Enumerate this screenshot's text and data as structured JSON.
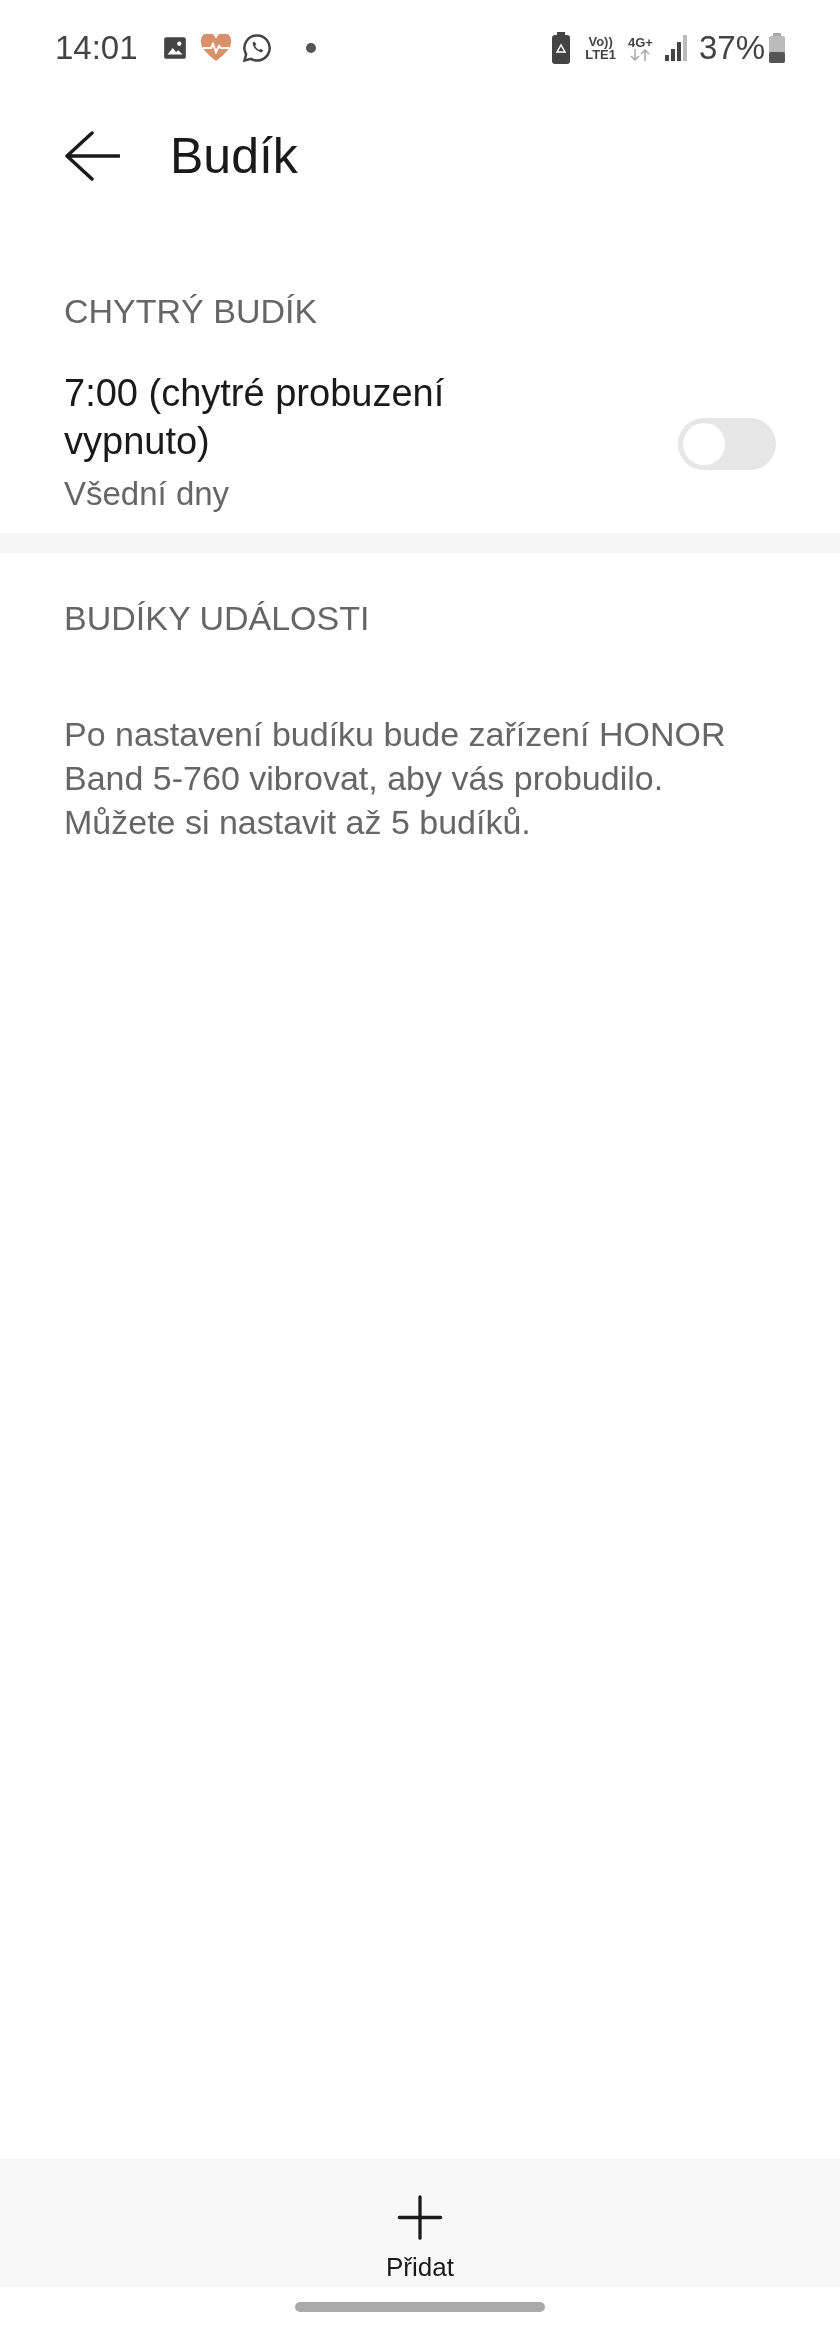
{
  "status_bar": {
    "time": "14:01",
    "volte_top": "Vo))",
    "volte_bottom": "LTE1",
    "network": "4G+",
    "battery": "37%"
  },
  "header": {
    "title": "Budík"
  },
  "sections": [
    {
      "title": "CHYTRÝ BUDÍK",
      "items": [
        {
          "title": "7:00 (chytré probuzení vypnuto)",
          "subtitle": "Všední dny",
          "on": false
        }
      ]
    },
    {
      "title": "BUDÍKY UDÁLOSTI",
      "description": "Po nastavení budíku bude zařízení HONOR Band 5-760 vibrovat, aby vás probudilo. Můžete si nastavit až 5 budíků."
    }
  ],
  "bottom_bar": {
    "add_label": "Přidat"
  }
}
